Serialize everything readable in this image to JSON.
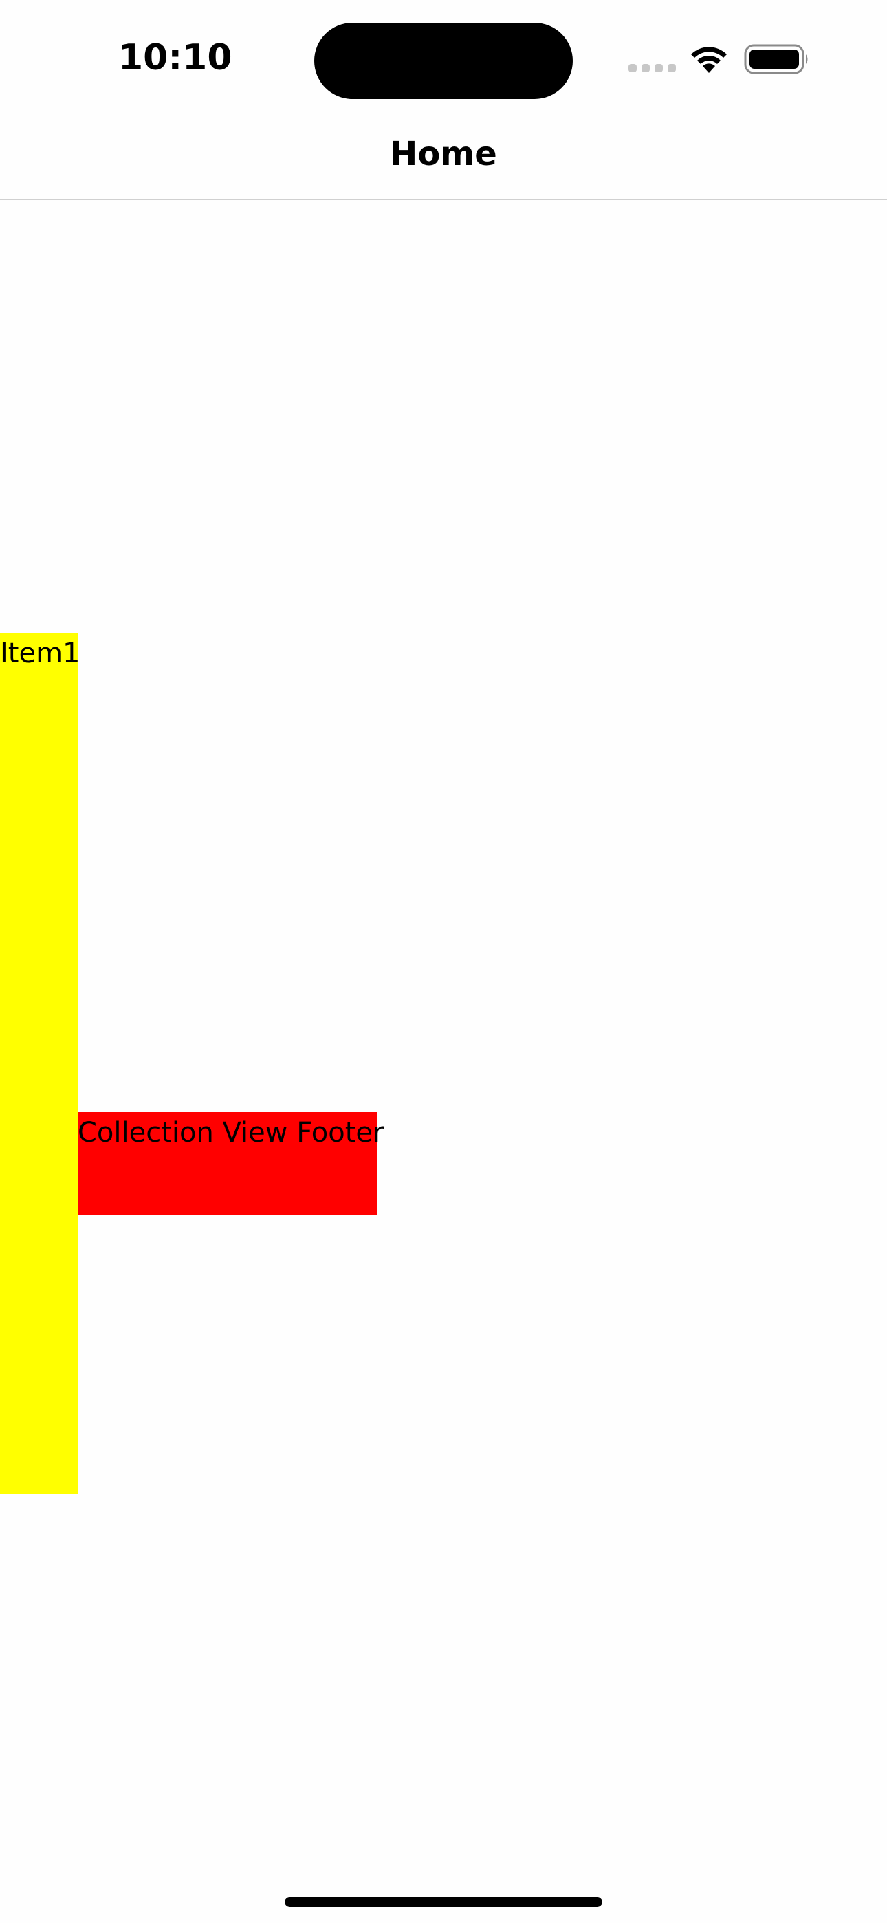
{
  "status_bar": {
    "time": "10:10",
    "icons": [
      "signal-icon",
      "wifi-icon",
      "battery-icon"
    ]
  },
  "nav_bar": {
    "title": "Home"
  },
  "collection": {
    "items": [
      {
        "label": "Item1",
        "color": "#ffff00"
      }
    ],
    "footer": {
      "label": "Collection View Footer",
      "color": "#ff0000"
    }
  }
}
